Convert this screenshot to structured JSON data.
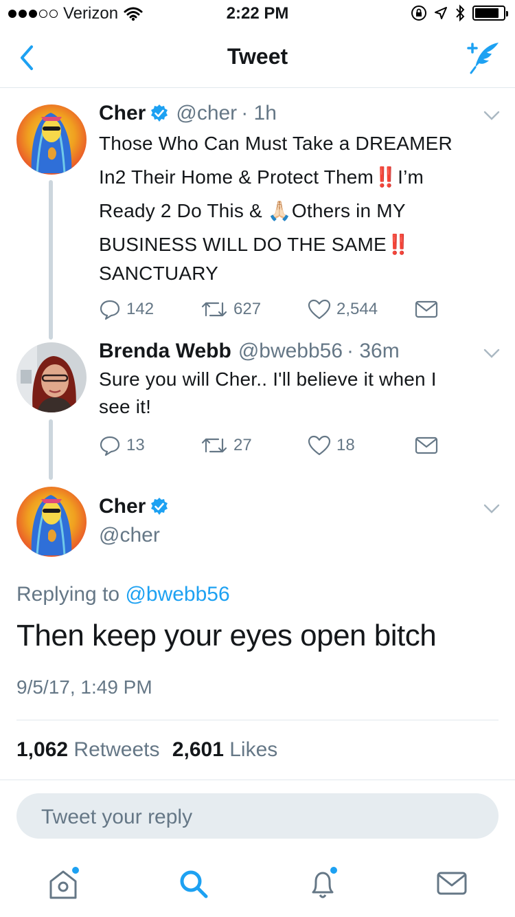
{
  "status_bar": {
    "carrier": "Verizon",
    "time": "2:22 PM",
    "signal_dots_filled": 3,
    "signal_dots_total": 5,
    "battery_level": 0.85
  },
  "nav": {
    "title": "Tweet",
    "back_icon": "chevron-left-icon",
    "compose_icon": "compose-tweet-icon"
  },
  "tweets": [
    {
      "name": "Cher",
      "verified": true,
      "handle": "@cher",
      "time": "· 1h",
      "lines": [
        "Those Who Can Must Take a DREAMER",
        "In2 Their Home & Protect Them‼️I’m",
        "Ready 2 Do This & 🙏🏻Others in MY",
        "BUSINESS WILL DO THE SAME‼️",
        "SANCTUARY"
      ],
      "replies": "142",
      "retweets": "627",
      "likes": "2,544"
    },
    {
      "name": "Brenda Webb",
      "verified": false,
      "handle": "@bwebb56",
      "time": "· 36m",
      "lines": [
        "Sure you will Cher.. I'll believe it when I",
        "see it!"
      ],
      "replies": "13",
      "retweets": "27",
      "likes": "18"
    }
  ],
  "focused_tweet": {
    "name": "Cher",
    "handle": "@cher",
    "replying_prefix": "Replying to ",
    "replying_to": "@bwebb56",
    "text": "Then keep your eyes open bitch",
    "datetime": "9/5/17, 1:49 PM",
    "retweet_count": "1,062",
    "retweet_label": "Retweets",
    "like_count": "2,601",
    "like_label": "Likes"
  },
  "reply_box": {
    "placeholder": "Tweet your reply"
  },
  "tabbar": {
    "items": [
      "home-icon",
      "search-icon",
      "notifications-icon",
      "messages-icon"
    ]
  },
  "colors": {
    "accent": "#1da1f2",
    "secondary_text": "#657786",
    "divider": "#e1e8ed"
  }
}
